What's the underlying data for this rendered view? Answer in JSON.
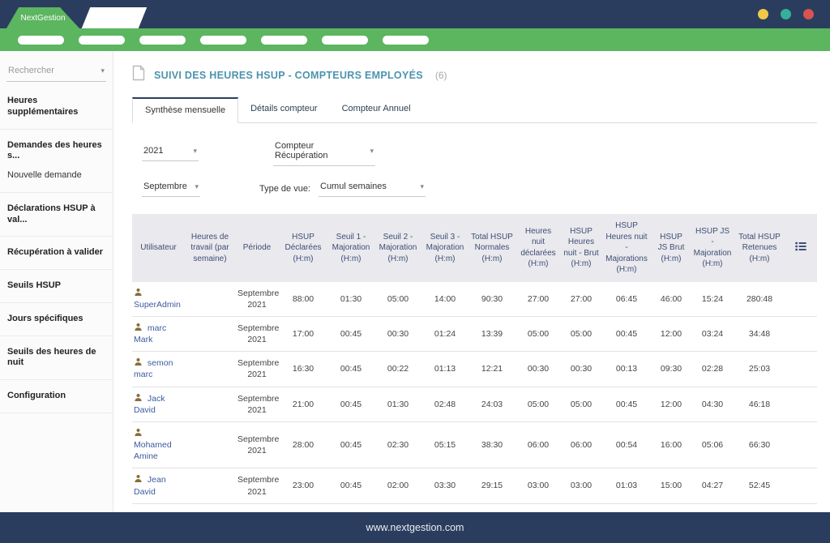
{
  "window": {
    "brand": "NextGestion",
    "traffic_lights": [
      "#f0c949",
      "#35b098",
      "#d9534f"
    ],
    "footer_url": "www.nextgestion.com"
  },
  "nav": {
    "pill_count": 7
  },
  "sidebar": {
    "search_placeholder": "Rechercher",
    "groups": [
      [
        "Heures supplémentaires"
      ],
      [
        "Demandes des heures s...",
        "Nouvelle demande"
      ],
      [
        "Déclarations HSUP à val..."
      ],
      [
        "Récupération à valider"
      ],
      [
        "Seuils HSUP"
      ],
      [
        "Jours spécifiques"
      ],
      [
        "Seuils des heures de nuit"
      ],
      [
        "Configuration"
      ]
    ]
  },
  "main": {
    "title": "SUIVI DES HEURES HSUP - COMPTEURS EMPLOYÉS",
    "title_count": "(6)",
    "tabs": [
      {
        "label": "Synthèse mensuelle",
        "active": true
      },
      {
        "label": "Détails compteur",
        "active": false
      },
      {
        "label": "Compteur Annuel",
        "active": false
      }
    ],
    "filters": {
      "year": "2021",
      "counter": "Compteur Récupération",
      "month": "Septembre",
      "view_label": "Type de vue:",
      "view": "Cumul semaines"
    },
    "table": {
      "headers": [
        "Utilisateur",
        "Heures de travail (par semaine)",
        "Période",
        "HSUP Déclarées (H:m)",
        "Seuil 1 - Majoration (H:m)",
        "Seuil 2 - Majoration (H:m)",
        "Seuil 3 - Majoration (H:m)",
        "Total HSUP Normales (H:m)",
        "Heures nuit déclarées (H:m)",
        "HSUP Heures nuit - Brut (H:m)",
        "HSUP Heures nuit - Majorations (H:m)",
        "HSUP JS Brut (H:m)",
        "HSUP JS - Majoration (H:m)",
        "Total HSUP Retenues (H:m)"
      ],
      "rows": [
        {
          "user": "SuperAdmin",
          "hours_per_week": "",
          "period": "Septembre 2021",
          "values": [
            "88:00",
            "01:30",
            "05:00",
            "14:00",
            "90:30",
            "27:00",
            "27:00",
            "06:45",
            "46:00",
            "15:24",
            "280:48"
          ]
        },
        {
          "user": "marc Mark",
          "hours_per_week": "",
          "period": "Septembre 2021",
          "values": [
            "17:00",
            "00:45",
            "00:30",
            "01:24",
            "13:39",
            "05:00",
            "05:00",
            "00:45",
            "12:00",
            "03:24",
            "34:48"
          ]
        },
        {
          "user": "semon marc",
          "hours_per_week": "",
          "period": "Septembre 2021",
          "values": [
            "16:30",
            "00:45",
            "00:22",
            "01:13",
            "12:21",
            "00:30",
            "00:30",
            "00:13",
            "09:30",
            "02:28",
            "25:03"
          ]
        },
        {
          "user": "Jack David",
          "hours_per_week": "",
          "period": "Septembre 2021",
          "values": [
            "21:00",
            "00:45",
            "01:30",
            "02:48",
            "24:03",
            "05:00",
            "05:00",
            "00:45",
            "12:00",
            "04:30",
            "46:18"
          ]
        },
        {
          "user": "Mohamed Amine",
          "hours_per_week": "",
          "period": "Septembre 2021",
          "values": [
            "28:00",
            "00:45",
            "02:30",
            "05:15",
            "38:30",
            "06:00",
            "06:00",
            "00:54",
            "16:00",
            "05:06",
            "66:30"
          ]
        },
        {
          "user": "Jean David",
          "hours_per_week": "",
          "period": "Septembre 2021",
          "values": [
            "23:00",
            "00:45",
            "02:00",
            "03:30",
            "29:15",
            "03:00",
            "03:00",
            "01:03",
            "15:00",
            "04:27",
            "52:45"
          ]
        }
      ]
    }
  },
  "colors": {
    "navy": "#2b3d5e",
    "green": "#5cb55f",
    "title_teal": "#4d93ad",
    "link_blue": "#3c5aa0",
    "header_text": "#3f4e73",
    "user_icon_brown": "#8a6d3b"
  }
}
